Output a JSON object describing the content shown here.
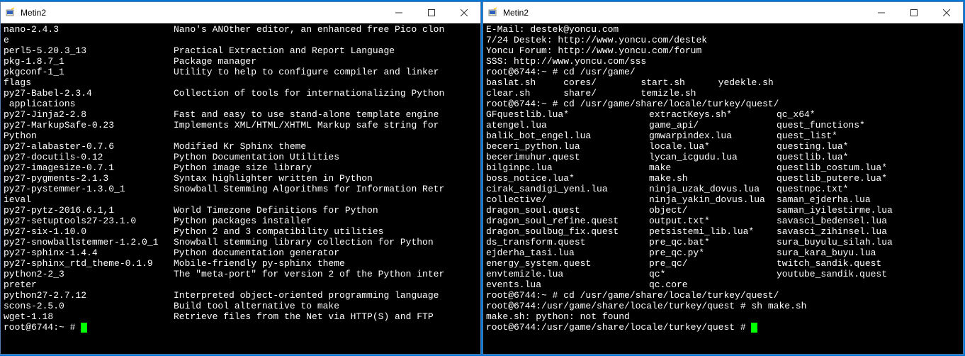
{
  "window_title": "Metin2",
  "left": {
    "packages": [
      {
        "name": "nano-2.4.3",
        "desc": "Nano's ANOther editor, an enhanced free Pico clon",
        "cont": "e"
      },
      {
        "name": "perl5-5.20.3_13",
        "desc": "Practical Extraction and Report Language"
      },
      {
        "name": "pkg-1.8.7_1",
        "desc": "Package manager"
      },
      {
        "name": "pkgconf-1_1",
        "desc": "Utility to help to configure compiler and linker ",
        "cont": "flags"
      },
      {
        "name": "py27-Babel-2.3.4",
        "desc": "Collection of tools for internationalizing Python",
        "cont": " applications"
      },
      {
        "name": "py27-Jinja2-2.8",
        "desc": "Fast and easy to use stand-alone template engine"
      },
      {
        "name": "py27-MarkupSafe-0.23",
        "desc": "Implements XML/HTML/XHTML Markup safe string for ",
        "cont": "Python"
      },
      {
        "name": "py27-alabaster-0.7.6",
        "desc": "Modified Kr Sphinx theme"
      },
      {
        "name": "py27-docutils-0.12",
        "desc": "Python Documentation Utilities"
      },
      {
        "name": "py27-imagesize-0.7.1",
        "desc": "Python image size library"
      },
      {
        "name": "py27-pygments-2.1.3",
        "desc": "Syntax highlighter written in Python"
      },
      {
        "name": "py27-pystemmer-1.3.0_1",
        "desc": "Snowball Stemming Algorithms for Information Retr",
        "cont": "ieval"
      },
      {
        "name": "py27-pytz-2016.6.1,1",
        "desc": "World Timezone Definitions for Python"
      },
      {
        "name": "py27-setuptools27-23.1.0",
        "desc": "Python packages installer"
      },
      {
        "name": "py27-six-1.10.0",
        "desc": "Python 2 and 3 compatibility utilities"
      },
      {
        "name": "py27-snowballstemmer-1.2.0_1",
        "desc": "Snowball stemming library collection for Python"
      },
      {
        "name": "py27-sphinx-1.4.4",
        "desc": "Python documentation generator"
      },
      {
        "name": "py27-sphinx_rtd_theme-0.1.9",
        "desc": "Mobile-friendly py-sphinx theme"
      },
      {
        "name": "python2-2_3",
        "desc": "The \"meta-port\" for version 2 of the Python inter",
        "cont": "preter"
      },
      {
        "name": "python27-2.7.12",
        "desc": "Interpreted object-oriented programming language"
      },
      {
        "name": "scons-2.5.0",
        "desc": "Build tool alternative to make"
      },
      {
        "name": "wget-1.18",
        "desc": "Retrieve files from the Net via HTTP(S) and FTP"
      }
    ],
    "prompt": "root@6744:~ # "
  },
  "right": {
    "header": [
      "E-Mail: destek@yoncu.com",
      "7/24 Destek: http://www.yoncu.com/destek",
      "Yoncu Forum: http://www.yoncu.com/forum",
      "SSS: http://www.yoncu.com/sss"
    ],
    "cmd1": "root@6744:~ # cd /usr/game/",
    "ls1": [
      [
        "baslat.sh",
        "cores/",
        "start.sh",
        "yedekle.sh"
      ],
      [
        "clear.sh",
        "share/",
        "temizle.sh",
        ""
      ]
    ],
    "cmd2": "root@6744:~ # cd /usr/game/share/locale/turkey/quest/",
    "files": [
      [
        "GFquestlib.lua*",
        "extractKeys.sh*",
        "qc_x64*"
      ],
      [
        "atengel.lua",
        "game_api/",
        "quest_functions*"
      ],
      [
        "balik_bot_engel.lua",
        "gmwarpindex.lua",
        "quest_list*"
      ],
      [
        "beceri_python.lua",
        "locale.lua*",
        "questing.lua*"
      ],
      [
        "becerimuhur.quest",
        "lycan_icgudu.lua",
        "questlib.lua*"
      ],
      [
        "bilginpc.lua",
        "make",
        "questlib_costum.lua*"
      ],
      [
        "boss_notice.lua*",
        "make.sh",
        "questlib_putere.lua*"
      ],
      [
        "cirak_sandigi_yeni.lua",
        "ninja_uzak_dovus.lua",
        "questnpc.txt*"
      ],
      [
        "collective/",
        "ninja_yakin_dovus.lua",
        "saman_ejderha.lua"
      ],
      [
        "dragon_soul.quest",
        "object/",
        "saman_iyilestirme.lua"
      ],
      [
        "dragon_soul_refine.quest",
        "output.txt*",
        "savasci_bedensel.lua"
      ],
      [
        "dragon_soulbug_fix.quest",
        "petsistemi_lib.lua*",
        "savasci_zihinsel.lua"
      ],
      [
        "ds_transform.quest",
        "pre_qc.bat*",
        "sura_buyulu_silah.lua"
      ],
      [
        "ejderha_tasi.lua",
        "pre_qc.py*",
        "sura_kara_buyu.lua"
      ],
      [
        "energy_system.quest",
        "pre_qc/",
        "twitch_sandik.quest"
      ],
      [
        "envtemizle.lua",
        "qc*",
        "youtube_sandik.quest"
      ],
      [
        "events.lua",
        "qc.core",
        ""
      ]
    ],
    "cmd3": "root@6744:~ # cd /usr/game/share/locale/turkey/quest/",
    "cmd4": "root@6744:/usr/game/share/locale/turkey/quest # sh make.sh",
    "err": "make.sh: python: not found",
    "prompt": "root@6744:/usr/game/share/locale/turkey/quest # "
  }
}
